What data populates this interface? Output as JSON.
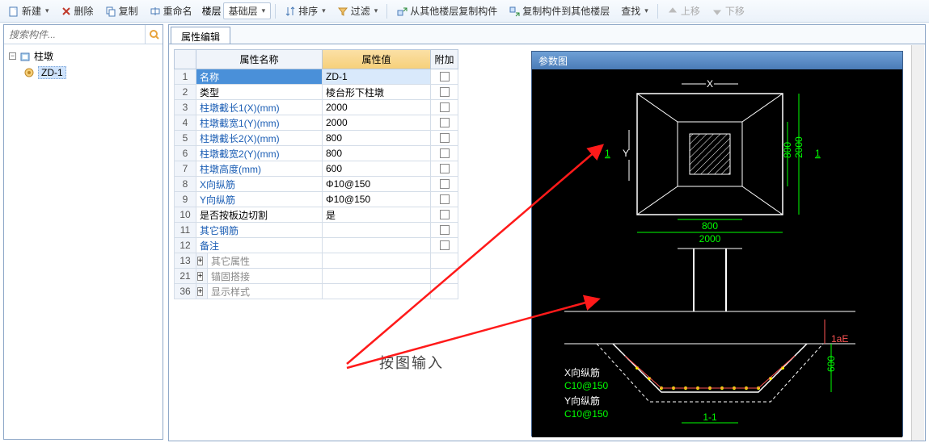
{
  "toolbar": {
    "new": "新建",
    "delete": "删除",
    "copy": "复制",
    "rename": "重命名",
    "layer": "楼层",
    "layer_value": "基础层",
    "sort": "排序",
    "filter": "过滤",
    "copy_from": "从其他楼层复制构件",
    "copy_to": "复制构件到其他楼层",
    "find": "查找",
    "up": "上移",
    "down": "下移"
  },
  "search": {
    "placeholder": "搜索构件..."
  },
  "tree": {
    "root": "柱墩",
    "child": "ZD-1"
  },
  "tab": {
    "label": "属性编辑"
  },
  "grid": {
    "head_name": "属性名称",
    "head_value": "属性值",
    "head_extra": "附加",
    "rows": [
      {
        "n": "1",
        "name": "名称",
        "value": "ZD-1",
        "sel": true
      },
      {
        "n": "2",
        "name": "类型",
        "value": "棱台形下柱墩"
      },
      {
        "n": "3",
        "name": "柱墩截长1(X)(mm)",
        "value": "2000",
        "link": true
      },
      {
        "n": "4",
        "name": "柱墩截宽1(Y)(mm)",
        "value": "2000",
        "link": true
      },
      {
        "n": "5",
        "name": "柱墩截长2(X)(mm)",
        "value": "800",
        "link": true
      },
      {
        "n": "6",
        "name": "柱墩截宽2(Y)(mm)",
        "value": "800",
        "link": true
      },
      {
        "n": "7",
        "name": "柱墩高度(mm)",
        "value": "600",
        "link": true
      },
      {
        "n": "8",
        "name": "X向纵筋",
        "value": "Φ10@150",
        "link": true
      },
      {
        "n": "9",
        "name": "Y向纵筋",
        "value": "Φ10@150",
        "link": true
      },
      {
        "n": "10",
        "name": "是否按板边切割",
        "value": "是"
      },
      {
        "n": "11",
        "name": "其它钢筋",
        "value": "",
        "link": true
      },
      {
        "n": "12",
        "name": "备注",
        "value": "",
        "link": true
      },
      {
        "n": "13",
        "name": "其它属性",
        "value": "",
        "exp": true,
        "mut": true
      },
      {
        "n": "21",
        "name": "锚固搭接",
        "value": "",
        "exp": true,
        "mut": true
      },
      {
        "n": "36",
        "name": "显示样式",
        "value": "",
        "exp": true,
        "mut": true
      }
    ]
  },
  "hint": "按图输入",
  "diagram": {
    "title": "参数图",
    "label_x": "X",
    "label_y": "Y",
    "dim_800a": "800",
    "dim_800b": "800",
    "dim_2000a": "2000",
    "dim_2000b": "2000",
    "sec1a": "1",
    "sec1b": "1",
    "x_rebar": "X向纵筋",
    "x_rebar_v": "C10@150",
    "y_rebar": "Y向纵筋",
    "y_rebar_v": "C10@150",
    "sec_label": "1-1",
    "laE": "1aE",
    "h600": "600"
  }
}
